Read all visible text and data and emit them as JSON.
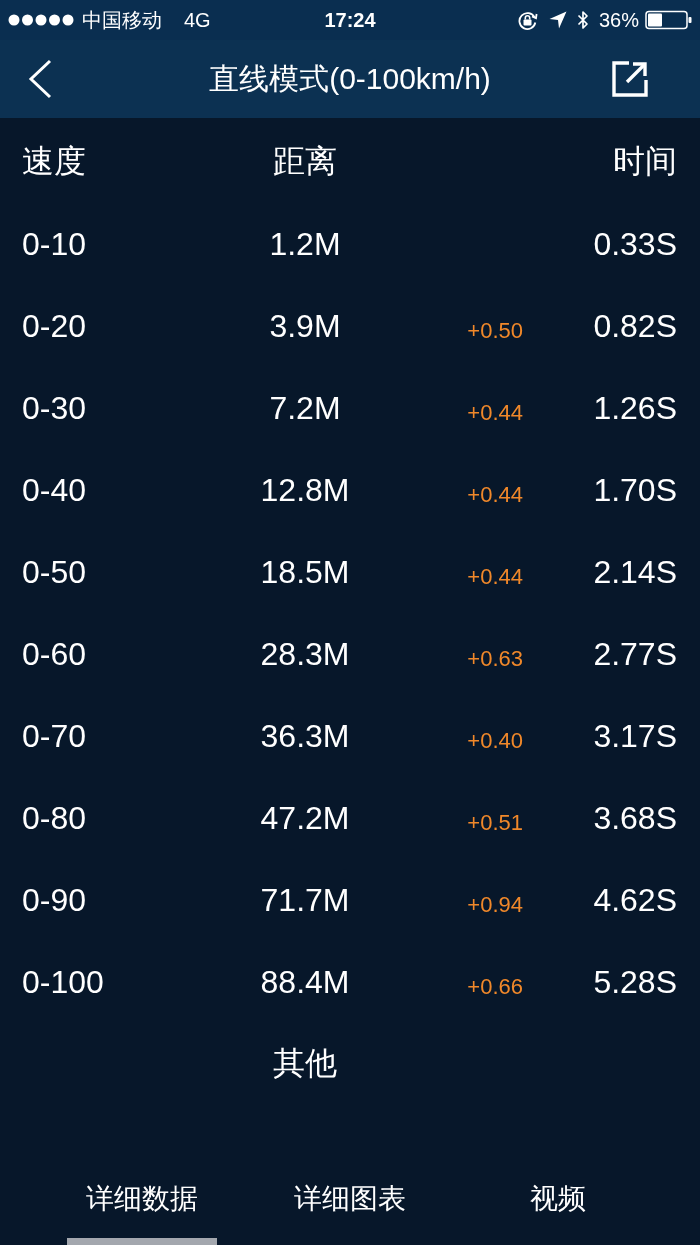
{
  "status_bar": {
    "carrier": "中国移动",
    "network": "4G",
    "time": "17:24",
    "battery": "36%"
  },
  "header": {
    "title": "直线模式(0-100km/h)"
  },
  "table": {
    "columns": [
      "速度",
      "距离",
      "时间"
    ],
    "rows": [
      {
        "speed": "0-10",
        "distance": "1.2M",
        "time": "0.33S"
      },
      {
        "speed": "0-20",
        "distance": "3.9M",
        "delta": "+0.50",
        "time": "0.82S"
      },
      {
        "speed": "0-30",
        "distance": "7.2M",
        "delta": "+0.44",
        "time": "1.26S"
      },
      {
        "speed": "0-40",
        "distance": "12.8M",
        "delta": "+0.44",
        "time": "1.70S"
      },
      {
        "speed": "0-50",
        "distance": "18.5M",
        "delta": "+0.44",
        "time": "2.14S"
      },
      {
        "speed": "0-60",
        "distance": "28.3M",
        "delta": "+0.63",
        "time": "2.77S"
      },
      {
        "speed": "0-70",
        "distance": "36.3M",
        "delta": "+0.40",
        "time": "3.17S"
      },
      {
        "speed": "0-80",
        "distance": "47.2M",
        "delta": "+0.51",
        "time": "3.68S"
      },
      {
        "speed": "0-90",
        "distance": "71.7M",
        "delta": "+0.94",
        "time": "4.62S"
      },
      {
        "speed": "0-100",
        "distance": "88.4M",
        "delta": "+0.66",
        "time": "5.28S"
      }
    ]
  },
  "section": {
    "title": "其他"
  },
  "tabs": [
    {
      "label": "详细数据",
      "selected": true
    },
    {
      "label": "详细图表",
      "selected": false
    },
    {
      "label": "视频",
      "selected": false
    }
  ]
}
